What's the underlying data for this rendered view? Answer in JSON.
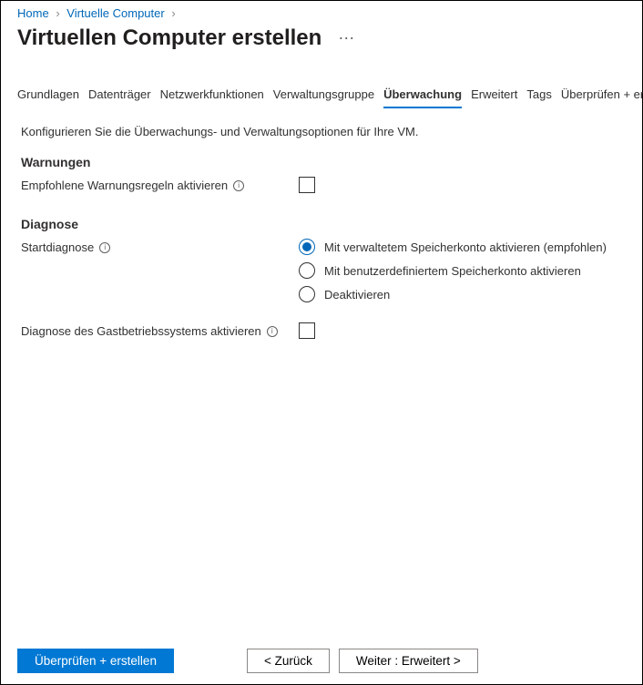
{
  "breadcrumb": {
    "home": "Home",
    "vms": "Virtuelle Computer"
  },
  "page_title": "Virtuellen Computer erstellen",
  "tabs": {
    "grundlagen": "Grundlagen",
    "datentraeger": "Datenträger",
    "netzwerk": "Netzwerkfunktionen",
    "verwaltung": "Verwaltungsgruppe",
    "ueberwachung": "Überwachung",
    "erweitert": "Erweitert",
    "tags": "Tags",
    "pruefen": "Überprüfen + erstellen"
  },
  "intro": "Konfigurieren Sie die Überwachungs- und Verwaltungsoptionen für Ihre VM.",
  "sections": {
    "warnungen_title": "Warnungen",
    "empfohlene_warnungsregeln_label": "Empfohlene Warnungsregeln aktivieren",
    "diagnose_title": "Diagnose",
    "startdiagnose_label": "Startdiagnose",
    "radio_managed": "Mit verwaltetem Speicherkonto aktivieren (empfohlen)",
    "radio_custom": "Mit benutzerdefiniertem Speicherkonto aktivieren",
    "radio_disable": "Deaktivieren",
    "gast_label": "Diagnose des Gastbetriebssystems aktivieren"
  },
  "footer": {
    "review": "Überprüfen + erstellen",
    "back": "<  Zurück",
    "next": "Weiter : Erweitert  >"
  }
}
